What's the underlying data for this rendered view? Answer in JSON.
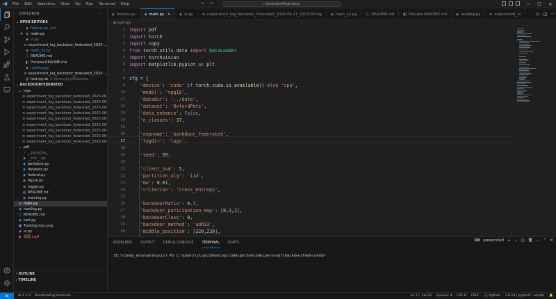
{
  "titlebar": {
    "menu": [
      "File",
      "Edit",
      "Selection",
      "View",
      "Go",
      "Run",
      "Terminal",
      "Help"
    ],
    "search_text": "backdoorFederated"
  },
  "sidebar": {
    "header": "EXPLORER",
    "open_editors_header": "OPEN EDITORS",
    "open_editors": [
      {
        "label": "federal.py",
        "desc": "pdf",
        "icon": "python-icon",
        "color": "#4b8bbe",
        "closable": false
      },
      {
        "label": "main.py",
        "desc": "",
        "icon": "python-icon",
        "color": "#e0e0e0",
        "closable": true
      },
      {
        "label": "vi.py",
        "desc": "",
        "icon": "python-icon",
        "color": "#4b8bbe",
        "closable": false
      },
      {
        "label": "experiment_log_backdoor_federated_2025-...",
        "desc": "",
        "icon": "log-icon",
        "color": "#cccccc",
        "closable": false
      },
      {
        "label": "main_v2.py",
        "desc": "",
        "icon": "python-icon",
        "color": "#4b8bbe",
        "closable": false
      },
      {
        "label": "README.md",
        "desc": "",
        "icon": "info-icon",
        "color": "#cccccc",
        "closable": false
      },
      {
        "label": "Preview README.md",
        "desc": "",
        "icon": "preview-icon",
        "color": "#cccccc",
        "closable": false
      },
      {
        "label": "readlog.py",
        "desc": "",
        "icon": "python-icon",
        "color": "#4b8bbe",
        "closable": false
      },
      {
        "label": "experiment_log_backdoor_federated_2025-...",
        "desc": "",
        "icon": "log-icon",
        "color": "#cccccc",
        "closable": false
      },
      {
        "label": "test.ipynb",
        "desc": "C:\\Users\\jluyi\\Desktop",
        "icon": "notebook-icon",
        "color": "#cccccc",
        "closable": false
      }
    ],
    "project_header": "BACKDOORFEDERATED",
    "tree": [
      {
        "label": "logs",
        "type": "folder",
        "indent": 1,
        "color": "#cccccc"
      },
      {
        "label": "experiment_log_backdoor_federated_2025-06-...",
        "type": "log",
        "indent": 2,
        "color": "#a0a0a0"
      },
      {
        "label": "experiment_log_backdoor_federated_2025-06-...",
        "type": "log",
        "indent": 2,
        "color": "#a0a0a0"
      },
      {
        "label": "experiment_log_backdoor_federated_2025-06-...",
        "type": "log",
        "indent": 2,
        "color": "#a0a0a0"
      },
      {
        "label": "experiment_log_backdoor_federated_2025-06-...",
        "type": "log",
        "indent": 2,
        "color": "#a0a0a0"
      },
      {
        "label": "experiment_log_backdoor_federated_2025-06-...",
        "type": "log",
        "indent": 2,
        "color": "#a0a0a0"
      },
      {
        "label": "experiment_log_backdoor_federated_2025-06-...",
        "type": "log",
        "indent": 2,
        "color": "#a0a0a0"
      },
      {
        "label": "experiment_log_backdoor_federated_2025-06-...",
        "type": "log",
        "indent": 2,
        "color": "#a0a0a0"
      },
      {
        "label": "experiment_log_backdoor_federated_2025-06-...",
        "type": "log",
        "indent": 2,
        "color": "#a0a0a0"
      },
      {
        "label": "experiment_log_backdoor_federated_2025-06-...",
        "type": "log",
        "indent": 2,
        "color": "#a0a0a0"
      },
      {
        "label": "pdf",
        "type": "folder",
        "indent": 1,
        "color": "#cccccc"
      },
      {
        "label": "__pycache__",
        "type": "folder-closed",
        "indent": 2,
        "color": "#888888"
      },
      {
        "label": "__init__.py",
        "type": "py",
        "indent": 2,
        "color": "#888888"
      },
      {
        "label": "backdoor.py",
        "type": "py",
        "indent": 2,
        "color": "#cccccc"
      },
      {
        "label": "datasets.py",
        "type": "py",
        "indent": 2,
        "color": "#cccccc"
      },
      {
        "label": "federal.py",
        "type": "py",
        "indent": 2,
        "color": "#cccccc"
      },
      {
        "label": "figure.py",
        "type": "py",
        "indent": 2,
        "color": "#cccccc"
      },
      {
        "label": "logger.py",
        "type": "py",
        "indent": 2,
        "color": "#cccccc"
      },
      {
        "label": "README.txt",
        "type": "txt",
        "indent": 2,
        "color": "#cccccc"
      },
      {
        "label": "training.py",
        "type": "py",
        "indent": 2,
        "color": "#cccccc"
      },
      {
        "label": "main.py",
        "type": "py",
        "indent": 1,
        "color": "#ffffff",
        "selected": true
      },
      {
        "label": "readlog.py",
        "type": "py",
        "indent": 1,
        "color": "#cccccc"
      },
      {
        "label": "README.md",
        "type": "md",
        "indent": 1,
        "color": "#cccccc"
      },
      {
        "label": "test.py",
        "type": "py",
        "indent": 1,
        "color": "#cccccc"
      },
      {
        "label": "Training loss.png",
        "type": "img",
        "indent": 1,
        "color": "#cccccc"
      },
      {
        "label": "vi.py",
        "type": "py",
        "indent": 1,
        "color": "#cccccc"
      },
      {
        "label": "录屏.mp4",
        "type": "video",
        "indent": 1,
        "color": "#e06c75"
      }
    ],
    "outline_header": "OUTLINE",
    "timeline_header": "TIMELINE"
  },
  "tabs": [
    {
      "label": "federal.py",
      "active": false,
      "icon": "python-icon"
    },
    {
      "label": "main.py",
      "active": true,
      "icon": "python-icon"
    },
    {
      "label": "vi.py",
      "active": false,
      "icon": "python-icon"
    },
    {
      "label": "experiment_log_backdoor_federated_2025-06-21_2253-06.log",
      "active": false,
      "icon": "log-icon"
    },
    {
      "label": "main_v2.py",
      "active": false,
      "icon": "python-icon"
    },
    {
      "label": "README.md",
      "active": false,
      "icon": "info-icon"
    },
    {
      "label": "Preview README.md",
      "active": false,
      "icon": "preview-icon"
    },
    {
      "label": "readlog.py",
      "active": false,
      "icon": "python-icon"
    },
    {
      "label": "experiment_lo",
      "active": false,
      "icon": "log-icon"
    }
  ],
  "breadcrumb": "main.py",
  "line_numbers": [
    "1",
    "2",
    "3",
    "4",
    "5",
    "6",
    "7",
    "8",
    "9",
    "10",
    "11",
    "12",
    "13",
    "14",
    "15",
    "16",
    "17",
    "18",
    "19",
    "20",
    "21",
    "22",
    "23",
    "24",
    "25",
    "26",
    "27",
    "28",
    "29",
    "30"
  ],
  "panel": {
    "tabs": [
      "PROBLEMS",
      "OUTPUT",
      "DEBUG CONSOLE",
      "TERMINAL",
      "PORTS"
    ],
    "active_tab": "TERMINAL",
    "shell": "powershell",
    "terminal_line": "(E:\\conda_envs\\analysis) PS C:\\Users\\jluyi\\Desktop\\code\\pythoncode\\personal\\backdoorFederated>"
  },
  "statusbar": {
    "left": [
      "⊗ 0 ⚠ 0",
      "Reactivating terminals..."
    ],
    "right": [
      "Ln 17, Col 22",
      "Spaces: 4",
      "UTF-8",
      "CRLF",
      "{} Python",
      "3.8.19 ('pytorch': conda)"
    ]
  }
}
